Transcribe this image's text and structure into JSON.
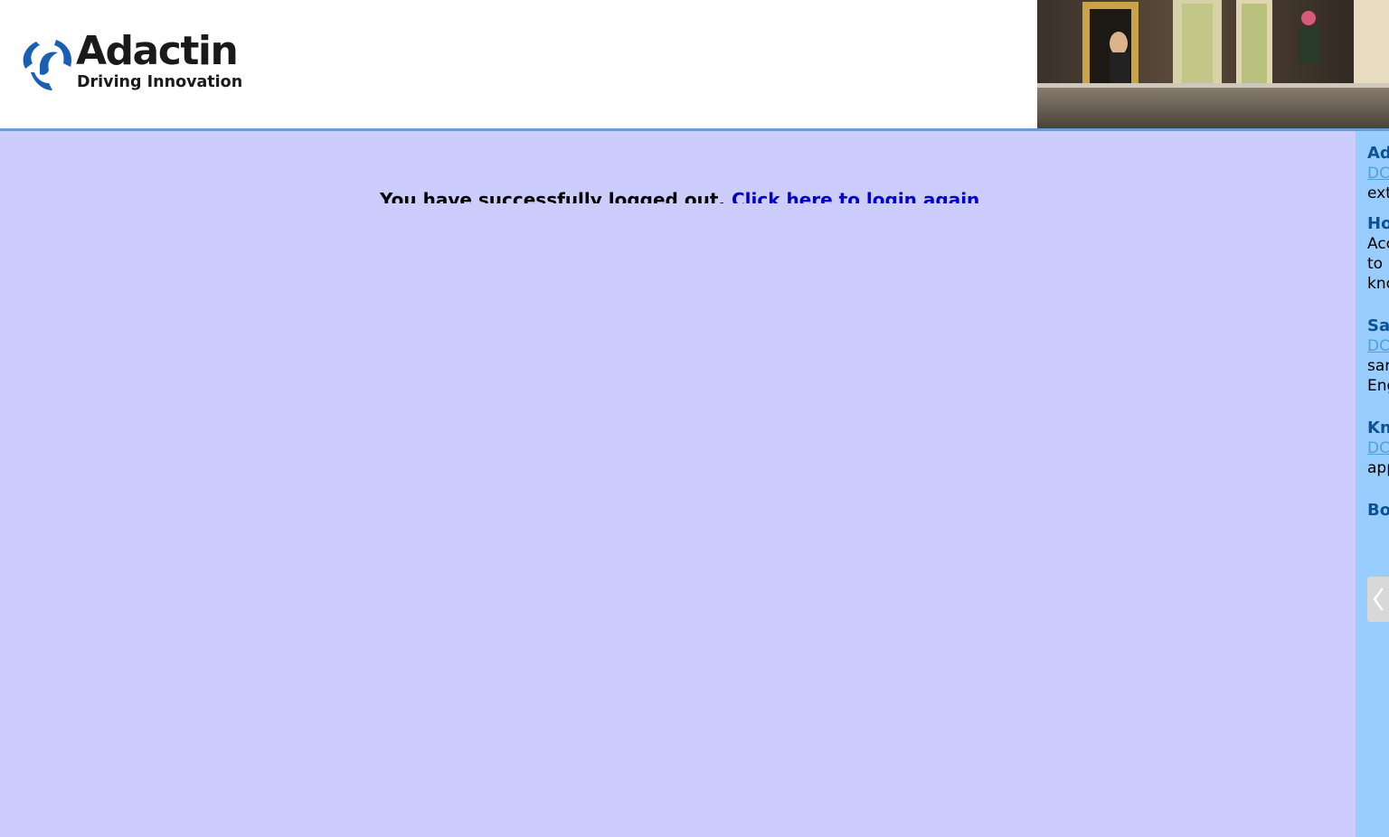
{
  "header": {
    "logo_name": "Adactin",
    "logo_tagline": "Driving Innovation"
  },
  "main": {
    "message": "You have successfully logged out.",
    "login_link": "Click here to login again"
  },
  "sidebar": {
    "items": [
      {
        "heading": "Ad",
        "link": "DC",
        "text": [
          "ext"
        ]
      },
      {
        "heading": "Ho",
        "text": [
          "Acc",
          "to",
          "kno"
        ]
      },
      {
        "heading": "Sa",
        "link": "DC",
        "text": [
          "sar",
          "Eng"
        ]
      },
      {
        "heading": "Kn",
        "link": "DC",
        "text": [
          "app"
        ]
      },
      {
        "heading": "Bo"
      }
    ]
  },
  "colors": {
    "main_bg": "#ccccfd",
    "sidebar_bg": "#99ccff",
    "link": "#0000cc",
    "sidebar_heading": "#0b5394"
  }
}
